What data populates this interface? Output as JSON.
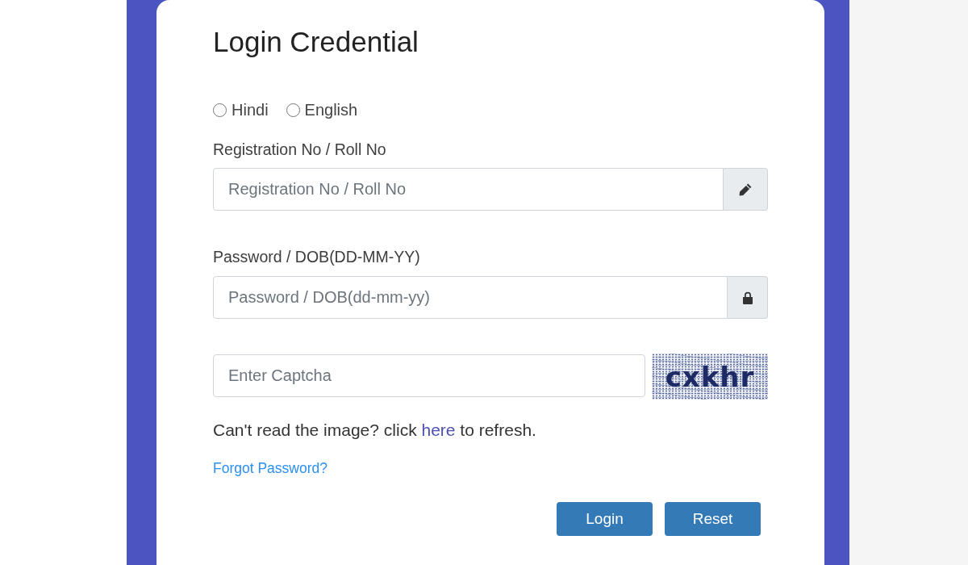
{
  "form": {
    "title": "Login Credential"
  },
  "languages": [
    {
      "label": "Hindi",
      "selected": false
    },
    {
      "label": "English",
      "selected": false
    }
  ],
  "fields": [
    {
      "label": "Registration No / Roll No",
      "placeholder": "Registration No / Roll No",
      "kind": "pencil"
    },
    {
      "label": "Password / DOB(DD-MM-YY)",
      "placeholder": "Password / DOB(dd-mm-yy)",
      "kind": "lock"
    }
  ],
  "captcha": {
    "placeholder": "Enter Captcha",
    "image_text": "cxkhr"
  },
  "refresh_hint": {
    "before": "Can't read the image? click ",
    "link": "here",
    "after": " to refresh."
  },
  "forgot_link": "Forgot Password?",
  "buttons": [
    "Login",
    "Reset"
  ]
}
